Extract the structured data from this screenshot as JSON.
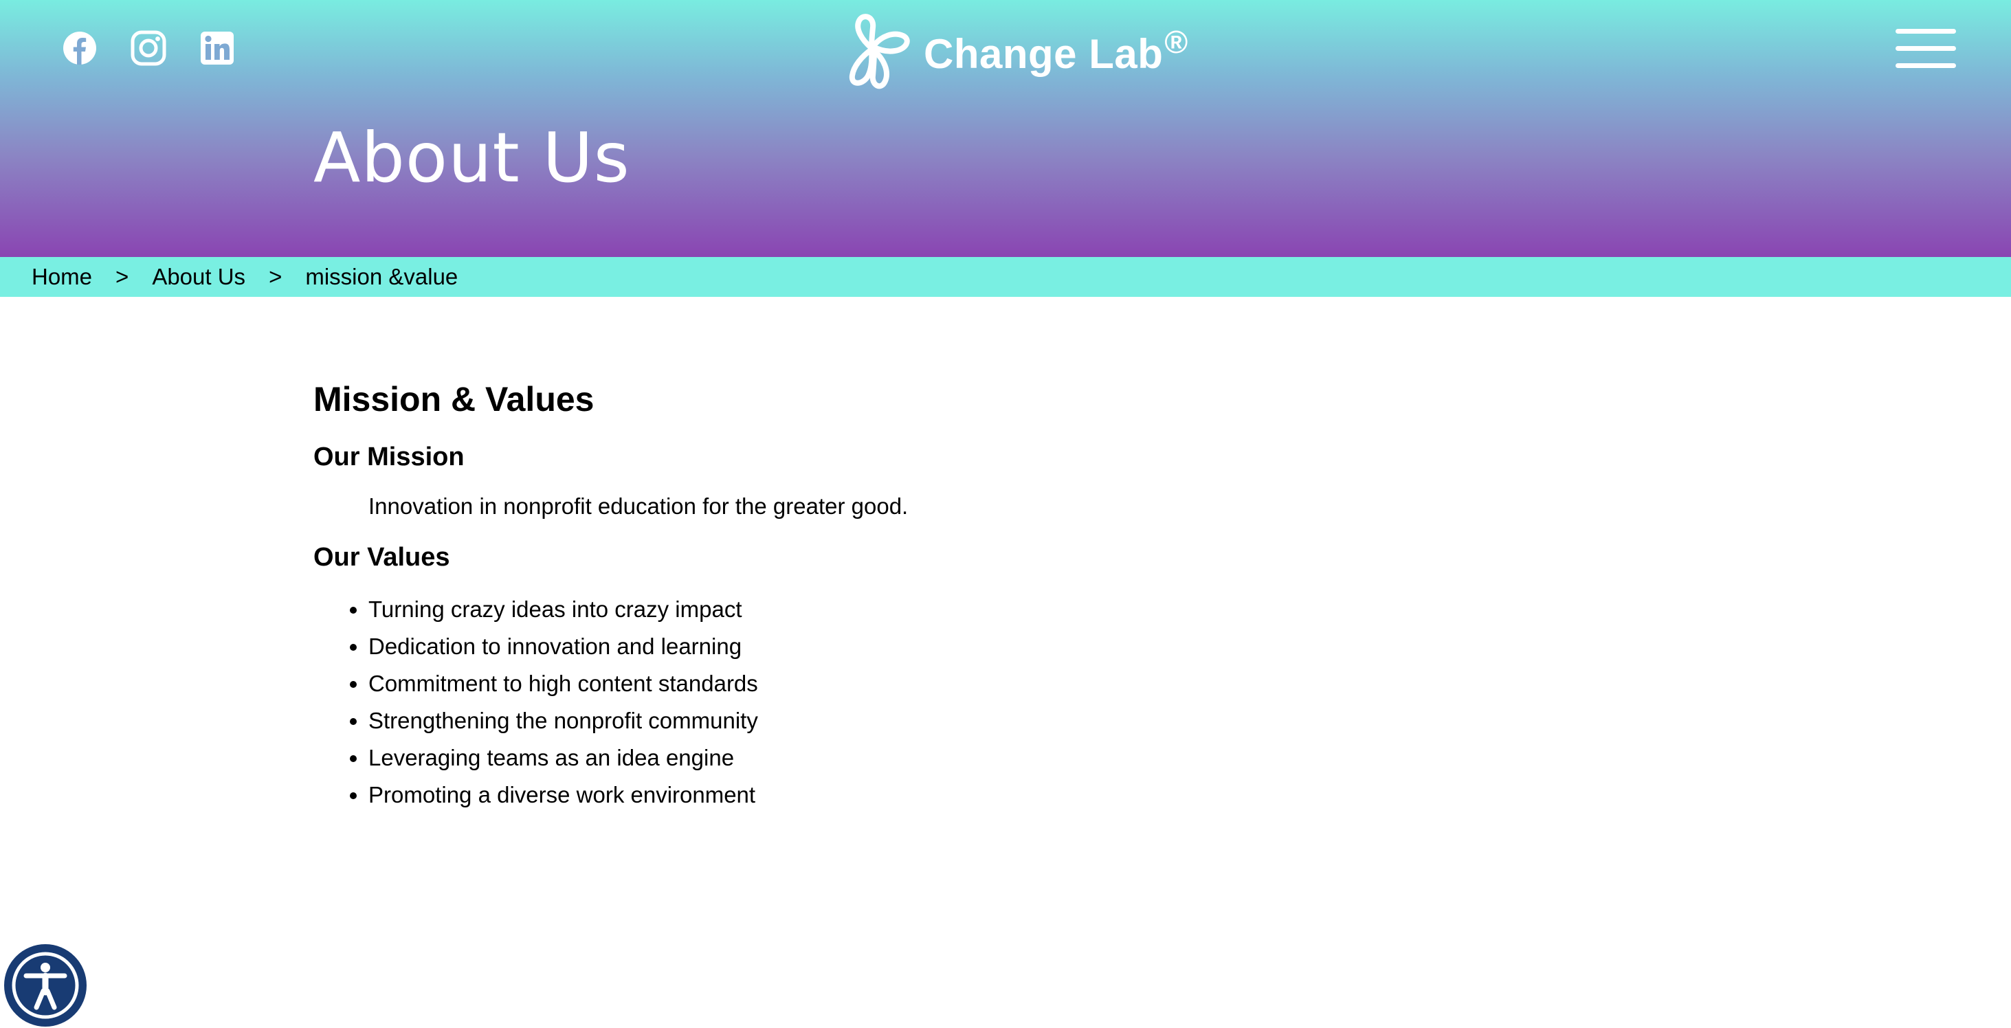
{
  "header": {
    "social_icons": [
      "facebook-icon",
      "instagram-icon",
      "linkedin-icon"
    ],
    "logo_text": "Change Lab",
    "logo_mark": "®",
    "menu_icon": "hamburger-menu-icon",
    "page_title": "About Us"
  },
  "breadcrumb": {
    "items": [
      "Home",
      "About Us",
      "mission &value"
    ],
    "separator": ">"
  },
  "main": {
    "heading": "Mission & Values",
    "mission": {
      "heading": "Our Mission",
      "text": "Innovation in nonprofit education for the greater good."
    },
    "values": {
      "heading": "Our Values",
      "items": [
        "Turning crazy ideas into crazy impact",
        "Dedication to innovation and learning",
        "Commitment to high content standards",
        "Strengthening the nonprofit community",
        "Leveraging teams as an idea engine",
        "Promoting a diverse work environment"
      ]
    }
  },
  "accessibility": {
    "icon": "accessibility-icon"
  },
  "colors": {
    "gradient_top": "#79ece0",
    "gradient_bottom": "#8a45b2",
    "breadcrumb_bg": "#79efe2",
    "accessibility_bg": "#183b73"
  }
}
